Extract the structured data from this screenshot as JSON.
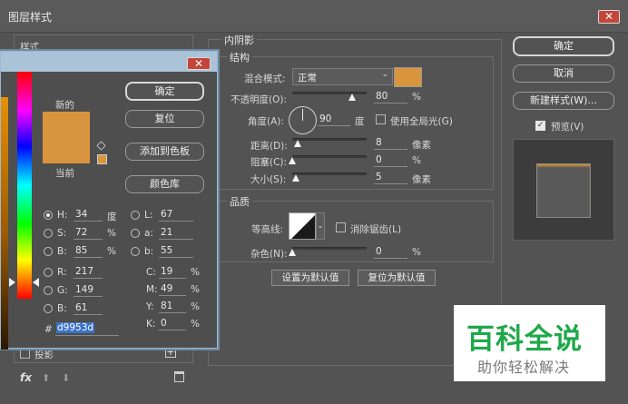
{
  "window": {
    "title": "图层样式",
    "close": "✕"
  },
  "left_panel": {
    "styles_label": "样式",
    "drop_shadow_label": "投影",
    "fx_label": "fx"
  },
  "inner_shadow": {
    "group_title": "内阴影",
    "structure": {
      "title": "结构",
      "blend_mode_label": "混合模式:",
      "blend_mode_value": "正常",
      "swatch_color": "#d9953d",
      "opacity_label": "不透明度(O):",
      "opacity_value": "80",
      "opacity_unit": "%",
      "opacity_level": 0.8,
      "angle_label": "角度(A):",
      "angle_value": "90",
      "angle_unit": "度",
      "global_light_label": "使用全局光(G)",
      "distance_label": "距离(D):",
      "distance_value": "8",
      "distance_unit": "像素",
      "choke_label": "阻塞(C):",
      "choke_value": "0",
      "choke_unit": "%",
      "size_label": "大小(S):",
      "size_value": "5",
      "size_unit": "像素"
    },
    "quality": {
      "title": "品质",
      "contour_label": "等高线:",
      "antialias_label": "消除锯齿(L)",
      "noise_label": "杂色(N):",
      "noise_value": "0",
      "noise_unit": "%"
    },
    "set_default_label": "设置为默认值",
    "reset_default_label": "复位为默认值"
  },
  "right_buttons": {
    "ok": "确定",
    "cancel": "取消",
    "new_style": "新建样式(W)...",
    "preview_label": "预览(V)"
  },
  "color_picker": {
    "close": "✕",
    "new_label": "新的",
    "current_label": "当前",
    "new_color": "#d9953d",
    "current_color": "#d9953d",
    "ok": "确定",
    "reset": "复位",
    "add_swatch": "添加到色板",
    "color_library": "颜色库",
    "H": {
      "label": "H:",
      "value": "34",
      "unit": "度"
    },
    "S": {
      "label": "S:",
      "value": "72",
      "unit": "%"
    },
    "Bv": {
      "label": "B:",
      "value": "85",
      "unit": "%"
    },
    "R": {
      "label": "R:",
      "value": "217"
    },
    "G": {
      "label": "G:",
      "value": "149"
    },
    "Bc": {
      "label": "B:",
      "value": "61"
    },
    "L": {
      "label": "L:",
      "value": "67"
    },
    "a": {
      "label": "a:",
      "value": "21"
    },
    "b": {
      "label": "b:",
      "value": "55"
    },
    "C": {
      "label": "C:",
      "value": "19",
      "unit": "%"
    },
    "M": {
      "label": "M:",
      "value": "49",
      "unit": "%"
    },
    "Y": {
      "label": "Y:",
      "value": "81",
      "unit": "%"
    },
    "K": {
      "label": "K:",
      "value": "0",
      "unit": "%"
    },
    "hex_label": "#",
    "hex_value": "d9953d"
  },
  "watermark": {
    "title": "百科全说",
    "subtitle": "助你轻松解决"
  }
}
